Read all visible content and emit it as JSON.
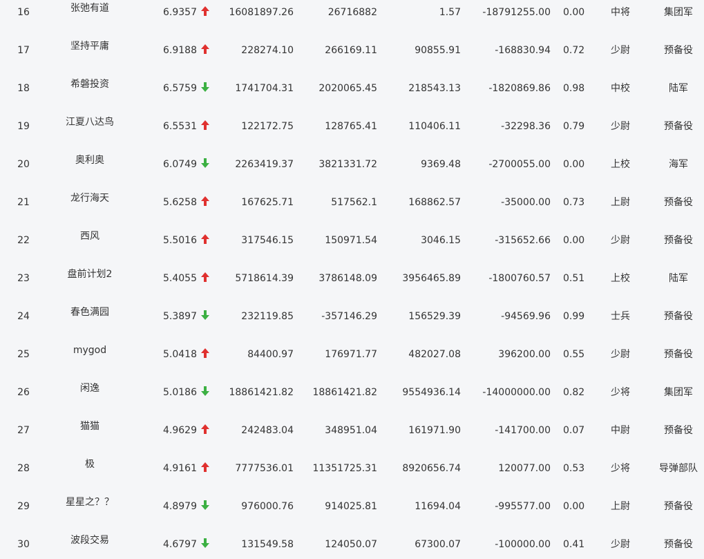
{
  "colors": {
    "up": "#e0312f",
    "down": "#3cb043",
    "background": "#f5f6f8",
    "text": "#333333"
  },
  "rows": [
    {
      "rank": "16",
      "name": "张弛有道",
      "score": "6.9357",
      "trend": "up",
      "v1": "16081897.26",
      "v2": "26716882",
      "v3": "1.57",
      "v4": "-18791255.00",
      "ratio": "0.00",
      "grade": "中将",
      "unit": "集团军"
    },
    {
      "rank": "17",
      "name": "坚持平庸",
      "score": "6.9188",
      "trend": "up",
      "v1": "228274.10",
      "v2": "266169.11",
      "v3": "90855.91",
      "v4": "-168830.94",
      "ratio": "0.72",
      "grade": "少尉",
      "unit": "预备役"
    },
    {
      "rank": "18",
      "name": "希磐投资",
      "score": "6.5759",
      "trend": "down",
      "v1": "1741704.31",
      "v2": "2020065.45",
      "v3": "218543.13",
      "v4": "-1820869.86",
      "ratio": "0.98",
      "grade": "中校",
      "unit": "陆军"
    },
    {
      "rank": "19",
      "name": "江夏八达鸟",
      "score": "6.5531",
      "trend": "up",
      "v1": "122172.75",
      "v2": "128765.41",
      "v3": "110406.11",
      "v4": "-32298.36",
      "ratio": "0.79",
      "grade": "少尉",
      "unit": "预备役"
    },
    {
      "rank": "20",
      "name": "奥利奥",
      "score": "6.0749",
      "trend": "down",
      "v1": "2263419.37",
      "v2": "3821331.72",
      "v3": "9369.48",
      "v4": "-2700055.00",
      "ratio": "0.00",
      "grade": "上校",
      "unit": "海军"
    },
    {
      "rank": "21",
      "name": "龙行海天",
      "score": "5.6258",
      "trend": "up",
      "v1": "167625.71",
      "v2": "517562.1",
      "v3": "168862.57",
      "v4": "-35000.00",
      "ratio": "0.73",
      "grade": "上尉",
      "unit": "预备役"
    },
    {
      "rank": "22",
      "name": "西风",
      "score": "5.5016",
      "trend": "up",
      "v1": "317546.15",
      "v2": "150971.54",
      "v3": "3046.15",
      "v4": "-315652.66",
      "ratio": "0.00",
      "grade": "少尉",
      "unit": "预备役"
    },
    {
      "rank": "23",
      "name": "盘前计划2",
      "score": "5.4055",
      "trend": "up",
      "v1": "5718614.39",
      "v2": "3786148.09",
      "v3": "3956465.89",
      "v4": "-1800760.57",
      "ratio": "0.51",
      "grade": "上校",
      "unit": "陆军"
    },
    {
      "rank": "24",
      "name": "春色满园",
      "score": "5.3897",
      "trend": "down",
      "v1": "232119.85",
      "v2": "-357146.29",
      "v3": "156529.39",
      "v4": "-94569.96",
      "ratio": "0.99",
      "grade": "士兵",
      "unit": "预备役"
    },
    {
      "rank": "25",
      "name": "mygod",
      "score": "5.0418",
      "trend": "up",
      "v1": "84400.97",
      "v2": "176971.77",
      "v3": "482027.08",
      "v4": "396200.00",
      "ratio": "0.55",
      "grade": "少尉",
      "unit": "预备役"
    },
    {
      "rank": "26",
      "name": "闲逸",
      "score": "5.0186",
      "trend": "down",
      "v1": "18861421.82",
      "v2": "18861421.82",
      "v3": "9554936.14",
      "v4": "-14000000.00",
      "ratio": "0.82",
      "grade": "少将",
      "unit": "集团军"
    },
    {
      "rank": "27",
      "name": "猫猫",
      "score": "4.9629",
      "trend": "up",
      "v1": "242483.04",
      "v2": "348951.04",
      "v3": "161971.90",
      "v4": "-141700.00",
      "ratio": "0.07",
      "grade": "中尉",
      "unit": "预备役"
    },
    {
      "rank": "28",
      "name": "极",
      "score": "4.9161",
      "trend": "up",
      "v1": "7777536.01",
      "v2": "11351725.31",
      "v3": "8920656.74",
      "v4": "120077.00",
      "ratio": "0.53",
      "grade": "少将",
      "unit": "导弹部队"
    },
    {
      "rank": "29",
      "name": "星星之？？",
      "score": "4.8979",
      "trend": "down",
      "v1": "976000.76",
      "v2": "914025.81",
      "v3": "11694.04",
      "v4": "-995577.00",
      "ratio": "0.00",
      "grade": "上尉",
      "unit": "预备役"
    },
    {
      "rank": "30",
      "name": "波段交易",
      "score": "4.6797",
      "trend": "down",
      "v1": "131549.58",
      "v2": "124050.07",
      "v3": "67300.07",
      "v4": "-100000.00",
      "ratio": "0.41",
      "grade": "少尉",
      "unit": "预备役"
    }
  ]
}
